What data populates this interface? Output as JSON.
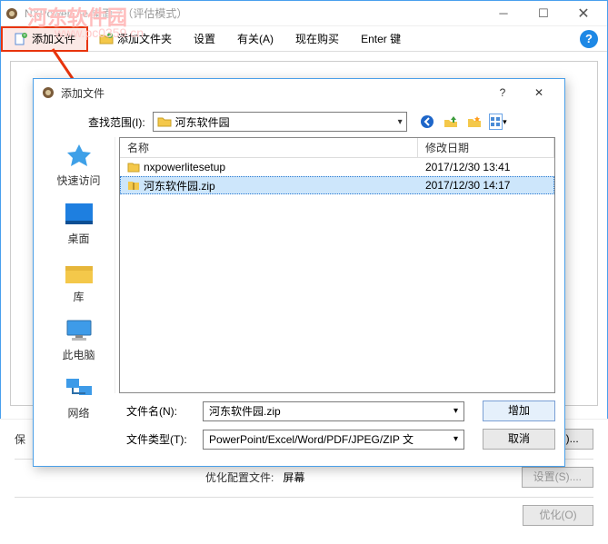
{
  "main": {
    "title": "NXPowerLite 桌面 7（评估模式）",
    "menu": {
      "add_file": "添加文件",
      "add_folder": "添加文件夹",
      "settings": "设置",
      "about": "有关(A)",
      "buy_now": "现在购买",
      "enter_key": "Enter 键"
    },
    "watermark": "河东软件园",
    "watermark_url": "www.pc0359.cn",
    "bottom": {
      "save_label": "保",
      "edit_btn": "编辑(I)...",
      "profile_label": "优化配置文件:",
      "profile_value": "屏幕",
      "settings_btn": "设置(S)....",
      "optimize_btn": "优化(O)"
    }
  },
  "dialog": {
    "title": "添加文件",
    "lookin_label": "查找范围(I):",
    "lookin_value": "河东软件园",
    "columns": {
      "name": "名称",
      "date": "修改日期"
    },
    "places": {
      "quick": "快速访问",
      "desktop": "桌面",
      "libraries": "库",
      "thispc": "此电脑",
      "network": "网络"
    },
    "rows": [
      {
        "name": "nxpowerlitesetup",
        "date": "2017/12/30 13:41",
        "selected": false,
        "icon": "folder"
      },
      {
        "name": "河东软件园.zip",
        "date": "2017/12/30 14:17",
        "selected": true,
        "icon": "zip"
      }
    ],
    "filename_label": "文件名(N):",
    "filename_value": "河东软件园.zip",
    "filetype_label": "文件类型(T):",
    "filetype_value": "PowerPoint/Excel/Word/PDF/JPEG/ZIP 文",
    "add_btn": "增加",
    "cancel_btn": "取消"
  }
}
